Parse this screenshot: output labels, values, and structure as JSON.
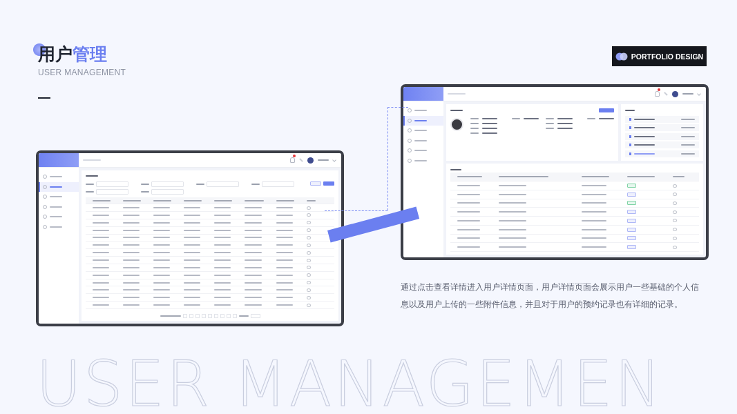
{
  "title": {
    "parts": [
      {
        "text": "用户",
        "accent": false
      },
      {
        "text": "管理",
        "accent": true
      }
    ]
  },
  "subtitle": "USER MANAGEMENT",
  "badge": "PORTFOLIO DESIGN",
  "description": "通过点击查看详情进入用户详情页面，用户详情页面会展示用户一些基础的个人信息以及用户上传的一些附件信息，并且对于用户的预约记录也有详细的记录。",
  "background_text": "USER MANAGEMEN"
}
